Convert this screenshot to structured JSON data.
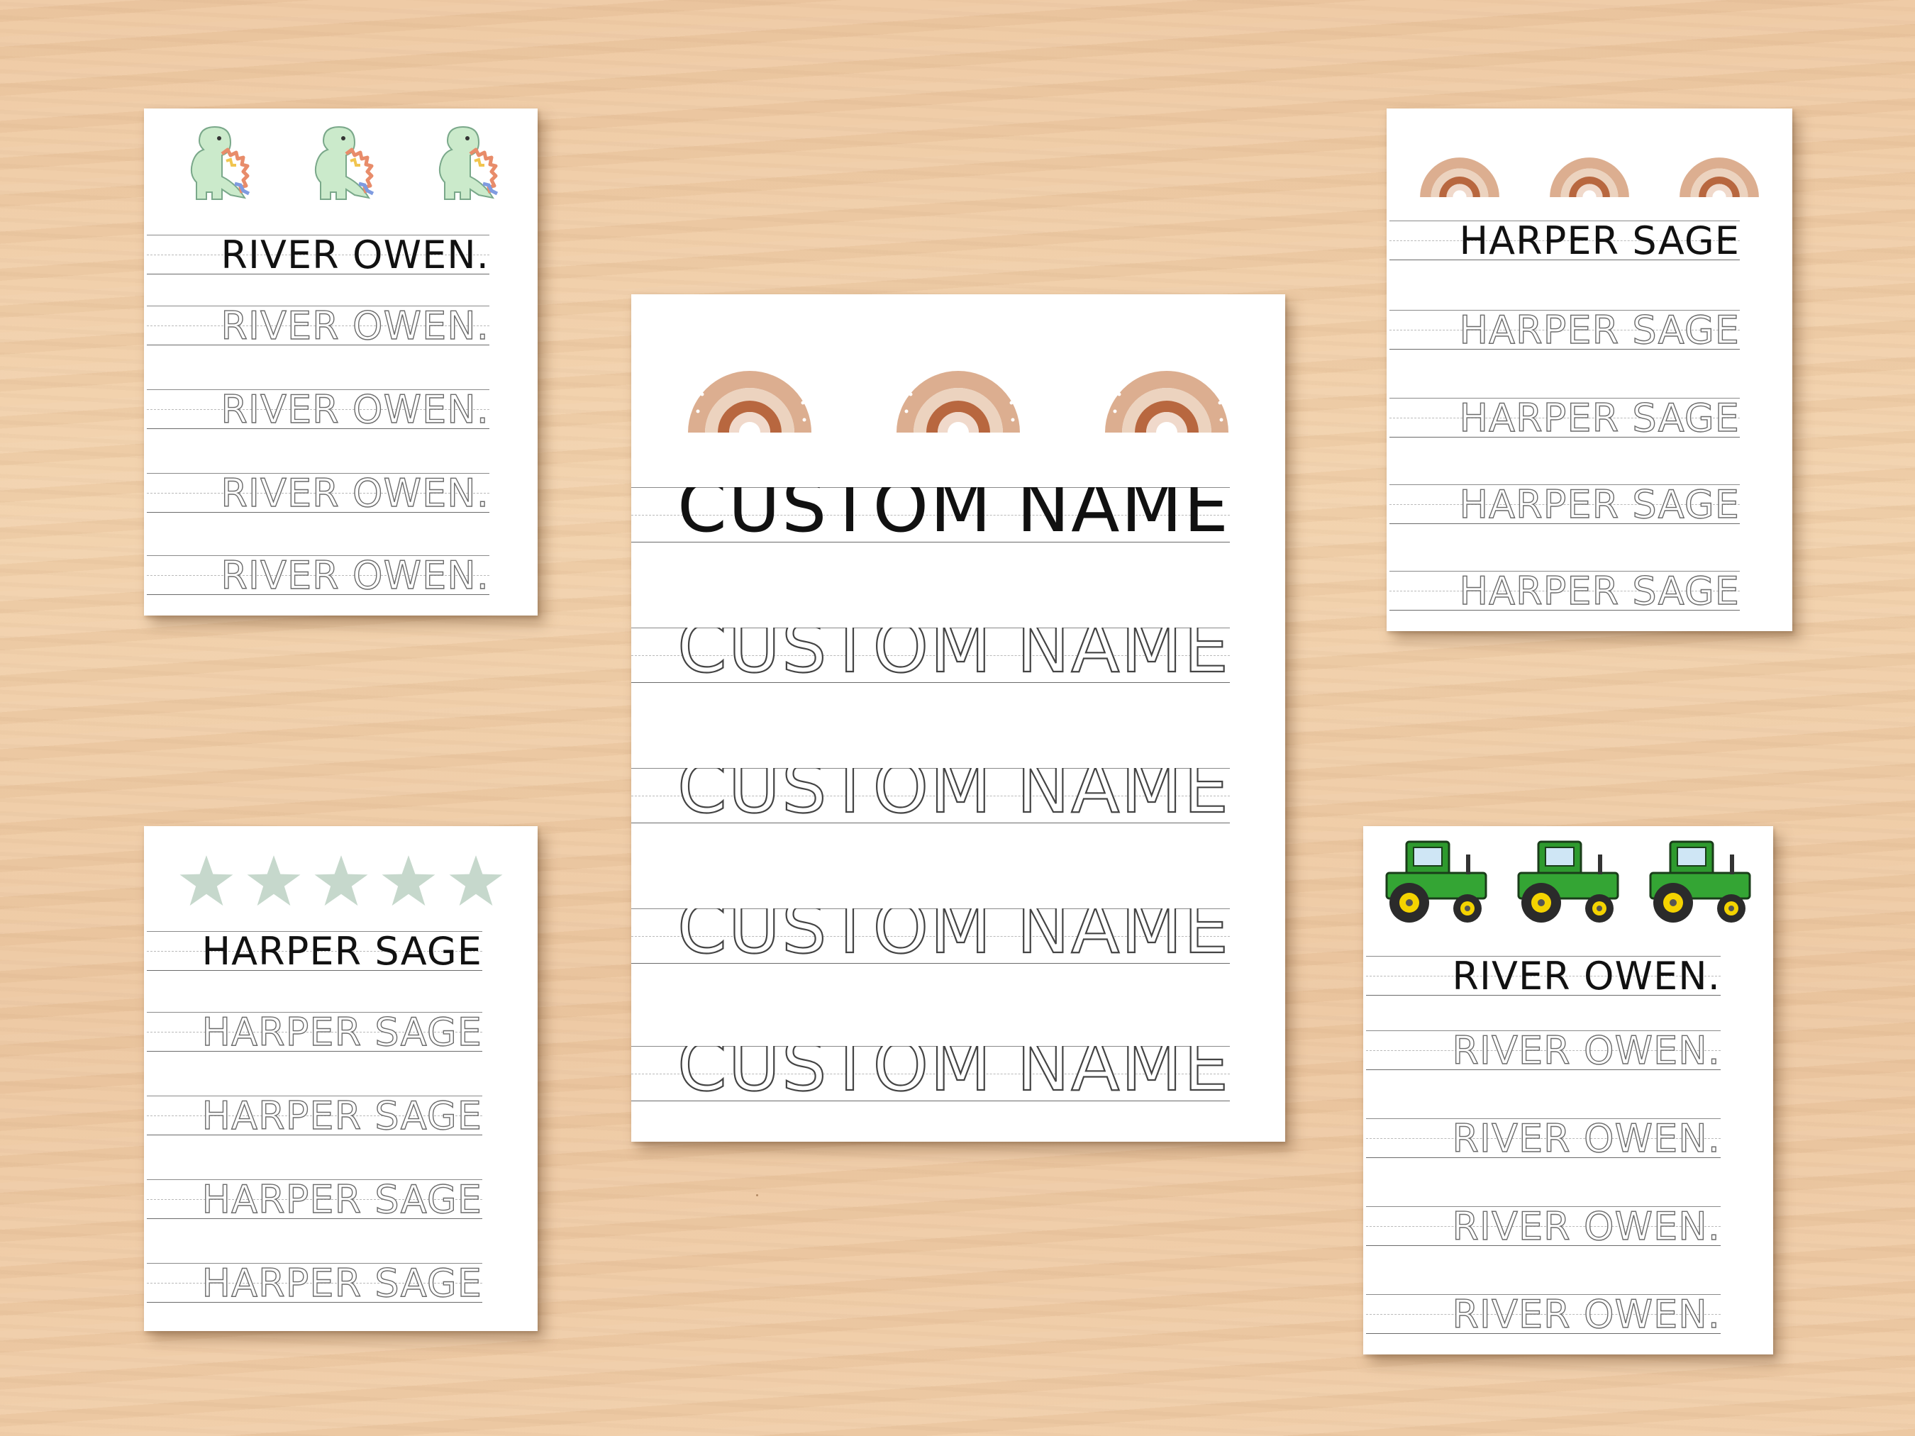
{
  "sheets": {
    "dino": {
      "name": "RIVER OWEN.",
      "icon": "dinosaur-icon"
    },
    "stars": {
      "name": "HARPER SAGE",
      "icon": "star-icon"
    },
    "rainbow_main": {
      "name": "CUSTOM NAME",
      "icon": "rainbow-icon"
    },
    "rainbow_small": {
      "name": "HARPER SAGE",
      "icon": "rainbow-icon"
    },
    "tractor": {
      "name": "RIVER OWEN.",
      "icon": "tractor-icon"
    }
  },
  "colors": {
    "wood": "#efcca6",
    "paper": "#ffffff",
    "ink": "#111111",
    "trace": "#6b6b6b",
    "dino_green": "#c9e9c6",
    "star_sage": "#c8d9cd",
    "rainbow_tan": "#d9a98a",
    "rainbow_rust": "#b86a45",
    "tractor_green": "#2e9a2e",
    "tractor_yellow": "#f4d300"
  }
}
